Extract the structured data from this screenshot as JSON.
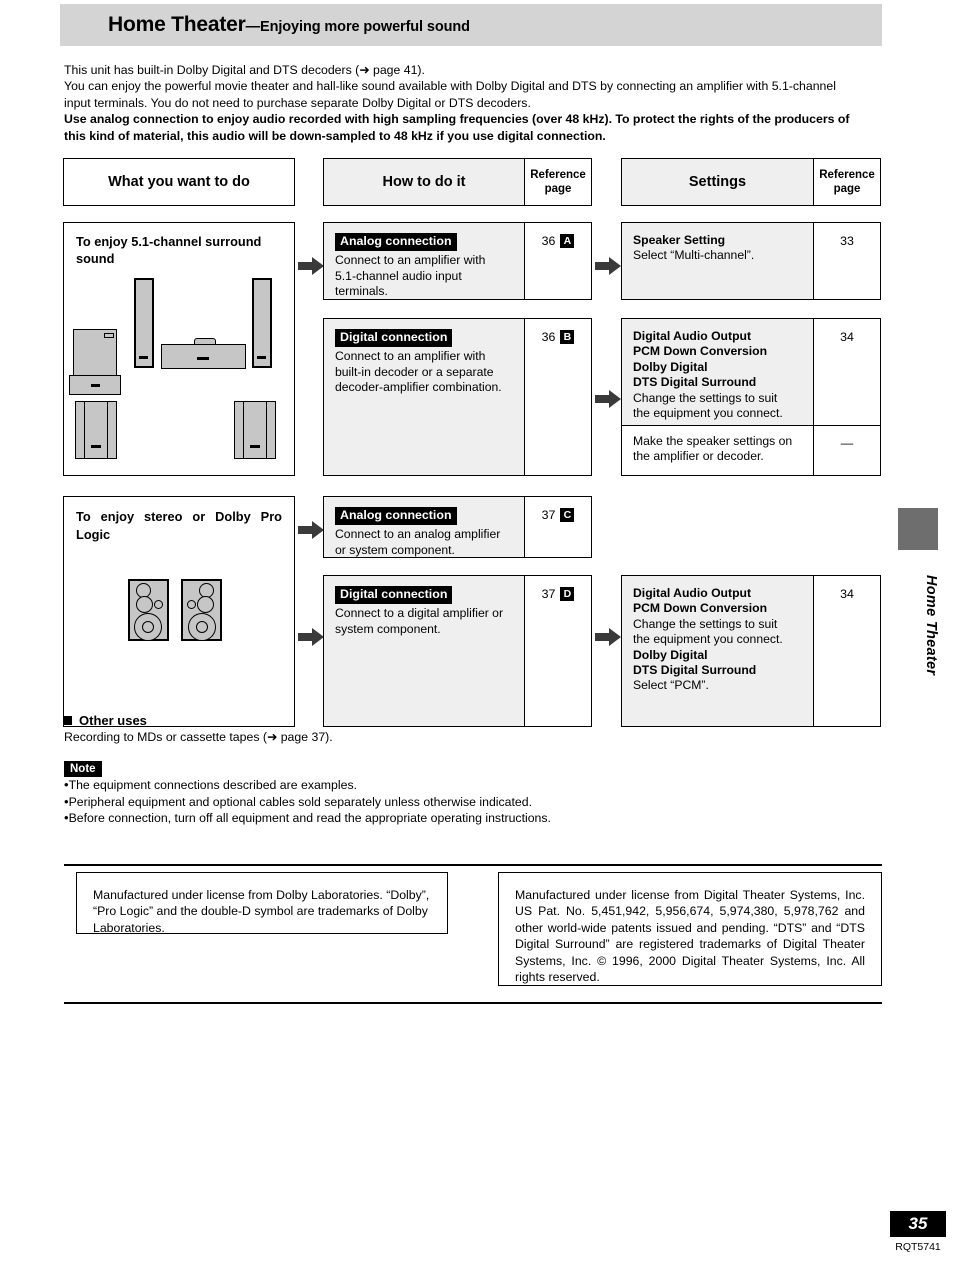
{
  "header": {
    "title": "Home Theater",
    "subtitle": "—Enjoying more powerful sound"
  },
  "intro": {
    "line1": "This unit has built-in Dolby Digital and DTS decoders (➜ page 41).",
    "line2": "You can enjoy the powerful movie theater and hall-like sound available with Dolby Digital and DTS by connecting an amplifier with 5.1-channel",
    "line3": "input terminals. You do not need to purchase separate Dolby Digital or DTS decoders.",
    "bold1": "Use analog connection to enjoy audio recorded with high sampling frequencies (over 48 kHz). To protect the rights of the producers of",
    "bold2": "this kind of material, this audio will be down-sampled to 48 kHz if you use digital connection."
  },
  "table": {
    "headers": {
      "what": "What you want to do",
      "how": "How to do it",
      "ref1_line1": "Reference",
      "ref1_line2": "page",
      "settings": "Settings",
      "ref2_line1": "Reference",
      "ref2_line2": "page"
    },
    "row1": {
      "what": "To enjoy 5.1-channel surround sound",
      "how_a": {
        "label": "Analog connection",
        "body_l1": "Connect to an amplifier with",
        "body_l2": "5.1-channel audio input",
        "body_l3": "terminals.",
        "ref_page": "36",
        "ref_badge": "A"
      },
      "how_b": {
        "label": "Digital connection",
        "body_l1": "Connect to an amplifier with",
        "body_l2": "built-in decoder or a separate",
        "body_l3": "decoder-amplifier combination.",
        "ref_page": "36",
        "ref_badge": "B"
      },
      "setting_a": {
        "title": "Speaker Setting",
        "body": "Select “Multi-channel”.",
        "ref_page": "33"
      },
      "setting_b": {
        "t1": "Digital Audio Output",
        "t2": "PCM Down Conversion",
        "t3": "Dolby Digital",
        "t4": "DTS Digital Surround",
        "body_l1": "Change the settings to suit",
        "body_l2": "the equipment you connect.",
        "ref_page": "34"
      },
      "setting_c": {
        "body_l1": "Make the speaker settings on",
        "body_l2": "the amplifier or decoder.",
        "ref_page": "—"
      }
    },
    "row2": {
      "what": "To enjoy stereo or Dolby Pro Logic",
      "how_c": {
        "label": "Analog connection",
        "body_l1": "Connect to an analog amplifier",
        "body_l2": "or system component.",
        "ref_page": "37",
        "ref_badge": "C"
      },
      "how_d": {
        "label": "Digital connection",
        "body_l1": "Connect to a digital amplifier or",
        "body_l2": "system component.",
        "ref_page": "37",
        "ref_badge": "D"
      },
      "setting_d": {
        "t1": "Digital Audio Output",
        "t2": "PCM Down Conversion",
        "body_l1": "Change the settings to suit",
        "body_l2": "the equipment you connect.",
        "t3": "Dolby Digital",
        "t4": "DTS Digital Surround",
        "body_l3": "Select “PCM”.",
        "ref_page": "34"
      }
    }
  },
  "other_uses": {
    "heading": "Other uses",
    "text": "Recording to MDs or cassette tapes (➜ page 37)."
  },
  "note": {
    "badge": "Note",
    "items": [
      "The equipment connections described are examples.",
      "Peripheral equipment and optional cables sold separately unless otherwise indicated.",
      "Before connection, turn off all equipment and read the appropriate operating instructions."
    ]
  },
  "licenses": {
    "dolby": "Manufactured under license from Dolby Laboratories. “Dolby”, “Pro Logic” and the double-D symbol are trademarks of Dolby Laboratories.",
    "dts": "Manufactured under license from Digital Theater Systems, Inc. US Pat. No. 5,451,942, 5,956,674, 5,974,380, 5,978,762 and other world-wide patents issued and pending. “DTS” and “DTS Digital Surround” are registered trademarks of Digital Theater Systems, Inc. © 1996, 2000 Digital Theater Systems, Inc. All rights reserved."
  },
  "sidebar": {
    "label": "Home Theater"
  },
  "footer": {
    "page_number": "35",
    "code": "RQT5741"
  },
  "colors": {
    "header_band": "#d4d4d4",
    "cell_shade": "#efefef",
    "speaker_fill": "#c6c6c6",
    "arrow": "#3a3a3a",
    "side_tab": "#6e6e6e"
  }
}
